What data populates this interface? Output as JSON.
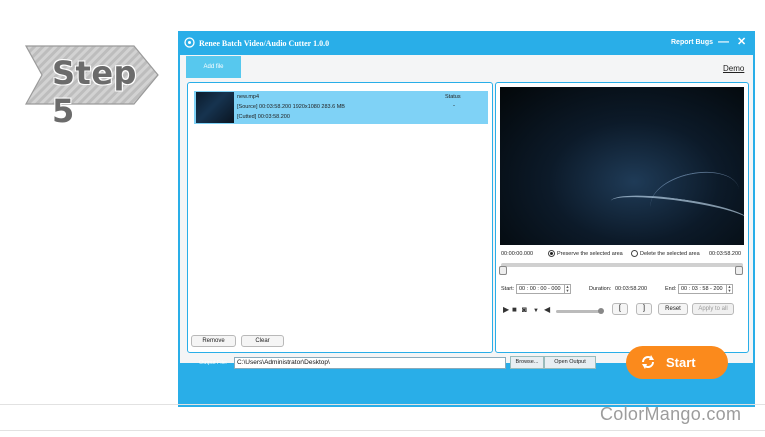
{
  "step_badge": {
    "text": "Step 5"
  },
  "window": {
    "title": "Renee Batch Video/Audio Cutter 1.0.0",
    "report_bugs": "Report Bugs",
    "minimize": "—",
    "close": "✕"
  },
  "toolbar": {
    "add_file": "Add file",
    "demo": "Demo"
  },
  "file_list": {
    "status_header": "Status",
    "items": [
      {
        "name": "new.mp4",
        "source": "[Source]   00:03:58.200   1920x1080   283.6 MB",
        "cutted": "[Cutted]   00:03:58.200",
        "status": "-"
      }
    ],
    "remove_label": "Remove",
    "clear_label": "Clear"
  },
  "player": {
    "time_start": "00:00:00.000",
    "time_end": "00:03:58.200",
    "preserve_label": "Preserve the selected area",
    "delete_label": "Delete the selected area",
    "preserve_selected": true,
    "start_label": "Start:",
    "start_value": "00 : 00 : 00 - 000",
    "duration_label": "Duration:",
    "duration_value": "00:03:58.200",
    "end_label": "End:",
    "end_value": "00 : 03 : 58 - 200",
    "bracket_open": "[",
    "bracket_close": "]",
    "reset_label": "Reset",
    "apply_label": "Apply to all",
    "volume_level": 0.95
  },
  "output": {
    "label": "Output File:",
    "path": "C:\\Users\\Administrator\\Desktop\\",
    "browse_label": "Browse...",
    "open_output_label": "Open Output",
    "start_label": "Start"
  },
  "footer": {
    "brand": "ColorMango.com"
  },
  "colors": {
    "window_blue": "#29aee8",
    "selected_row": "#7fd2f6",
    "start_orange": "#fb8a1c"
  }
}
